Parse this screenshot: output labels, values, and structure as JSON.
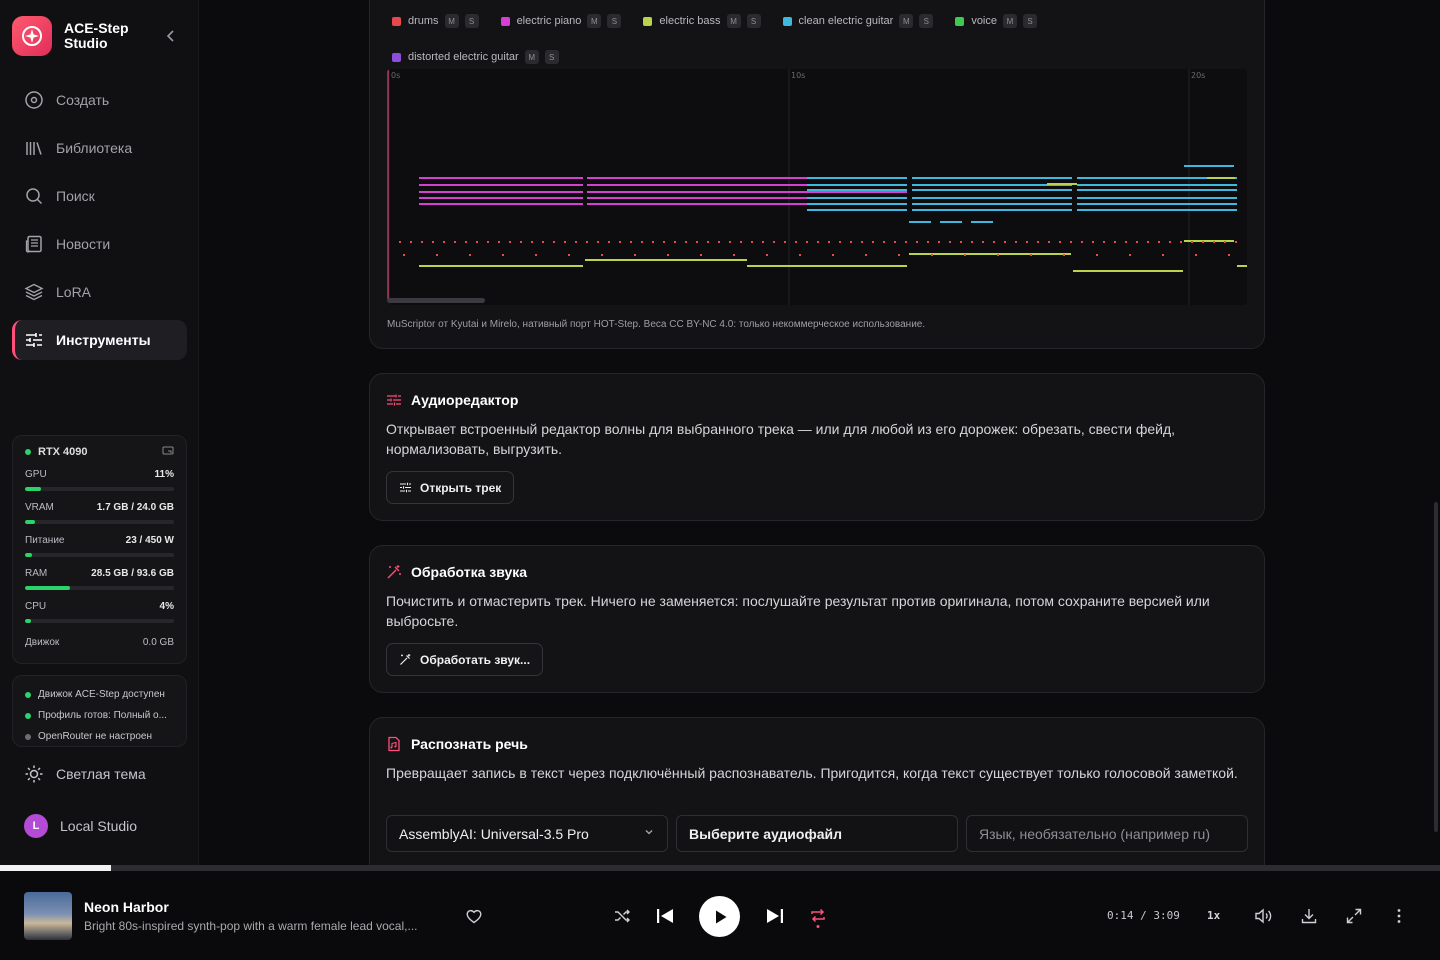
{
  "app": {
    "name": "ACE-Step Studio",
    "brand_line1": "ACE-Step",
    "brand_line2": "Studio"
  },
  "sidebar": {
    "items": [
      {
        "label": "Создать",
        "icon": "create-circle-icon"
      },
      {
        "label": "Библиотека",
        "icon": "library-icon"
      },
      {
        "label": "Поиск",
        "icon": "search-icon"
      },
      {
        "label": "Новости",
        "icon": "news-icon"
      },
      {
        "label": "LoRA",
        "icon": "layers-icon"
      },
      {
        "label": "Инструменты",
        "icon": "sliders-icon",
        "active": true
      }
    ],
    "theme_label": "Светлая тема",
    "studio_label": "Local Studio",
    "studio_initial": "L"
  },
  "gpu": {
    "name": "RTX 4090",
    "metrics": [
      {
        "label": "GPU",
        "value": "11%",
        "fill": 0.11
      },
      {
        "label": "VRAM",
        "value": "1.7 GB / 24.0 GB",
        "fill": 0.07
      },
      {
        "label": "Питание",
        "value": "23 / 450 W",
        "fill": 0.05
      },
      {
        "label": "RAM",
        "value": "28.5 GB / 93.6 GB",
        "fill": 0.3
      },
      {
        "label": "CPU",
        "value": "4%",
        "fill": 0.04
      }
    ],
    "engine_label": "Движок",
    "engine_value": "0.0 GB"
  },
  "status": [
    {
      "text": "Движок ACE-Step доступен",
      "ok": true
    },
    {
      "text": "Профиль готов: Полный о...",
      "ok": true
    },
    {
      "text": "OpenRouter не настроен",
      "ok": false
    }
  ],
  "midi": {
    "tracks": [
      {
        "name": "drums",
        "color": "#e5484d"
      },
      {
        "name": "electric piano",
        "color": "#d63fd1"
      },
      {
        "name": "electric bass",
        "color": "#b9d34a"
      },
      {
        "name": "clean electric guitar",
        "color": "#3fb8e0"
      },
      {
        "name": "voice",
        "color": "#3ccb4f"
      },
      {
        "name": "distorted electric guitar",
        "color": "#8c4fd9"
      }
    ],
    "mute_label": "M",
    "solo_label": "S",
    "time_labels": [
      "0s",
      "10s",
      "20s"
    ],
    "credit": "MuScriptor от Kyutai и Mirelo, нативный порт HOT-Step. Веса CC BY-NC 4.0: только некоммерческое использование."
  },
  "tools": {
    "editor": {
      "title": "Аудиоредактор",
      "description": "Открывает встроенный редактор волны для выбранного трека — или для любой из его дорожек: обрезать, свести фейд, нормализовать, выгрузить.",
      "button": "Открыть трек"
    },
    "fx": {
      "title": "Обработка звука",
      "description": "Почистить и отмастерить трек. Ничего не заменяется: послушайте результат против оригинала, потом сохраните версией или выбросьте.",
      "button": "Обработать звук..."
    },
    "asr": {
      "title": "Распознать речь",
      "description": "Превращает запись в текст через подключённый распознаватель. Пригодится, когда текст существует только голосовой заметкой.",
      "engine": "AssemblyAI: Universal-3.5 Pro",
      "file": "Выберите аудиофайл",
      "lang_placeholder": "Язык, необязательно (например ru)"
    }
  },
  "player": {
    "title": "Neon Harbor",
    "subtitle": "Bright 80s-inspired synth-pop with a warm female lead vocal,...",
    "time": "0:14 / 3:09",
    "speed": "1x",
    "progress": 0.077
  },
  "colors": {
    "accent": "#ff4f7a",
    "ok": "#2bd46a"
  }
}
